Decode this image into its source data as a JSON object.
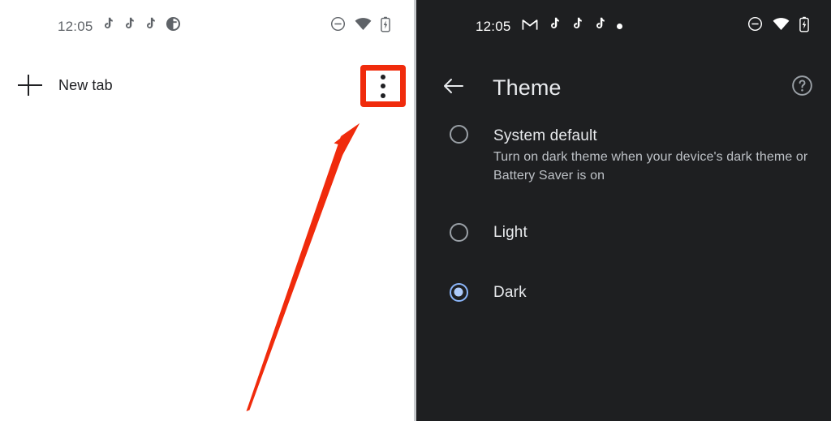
{
  "colors": {
    "light_bg": "#ffffff",
    "dark_bg": "#1e1f21",
    "accent_red": "#f02b0c",
    "radio_selected": "#8ab4f8",
    "text_primary_dark": "#e8eaed",
    "text_secondary_dark": "#bdc1c6",
    "text_primary_light": "#202124",
    "status_icon_light": "#5f6368"
  },
  "left_panel": {
    "status_bar": {
      "clock": "12:05",
      "notification_icons": [
        "tiktok-note-icon",
        "tiktok-note-icon",
        "tiktok-note-icon",
        "theme-contrast-circle-icon"
      ],
      "system_icons": [
        "do-not-disturb-icon",
        "wifi-icon",
        "battery-charging-icon"
      ]
    },
    "tab_strip": {
      "new_tab_label": "New tab",
      "new_tab_icon": "plus-icon",
      "overflow_icon": "three-dot-vertical-icon",
      "highlight": "red-rectangle-annotation"
    },
    "annotation": {
      "arrow": "red-arrow-pointing-to-overflow-menu"
    }
  },
  "right_panel": {
    "status_bar": {
      "clock": "12:05",
      "notification_icons": [
        "gmail-icon",
        "tiktok-note-icon",
        "tiktok-note-icon",
        "tiktok-note-icon",
        "notification-dot-icon"
      ],
      "system_icons": [
        "do-not-disturb-icon",
        "wifi-icon",
        "battery-charging-icon"
      ]
    },
    "app_bar": {
      "back_icon": "back-arrow-icon",
      "title": "Theme",
      "help_icon": "help-circle-icon"
    },
    "theme_options": [
      {
        "id": "system",
        "title": "System default",
        "subtitle": "Turn on dark theme when your device's dark theme or Battery Saver is on",
        "selected": false
      },
      {
        "id": "light",
        "title": "Light",
        "subtitle": "",
        "selected": false
      },
      {
        "id": "dark",
        "title": "Dark",
        "subtitle": "",
        "selected": true
      }
    ]
  }
}
